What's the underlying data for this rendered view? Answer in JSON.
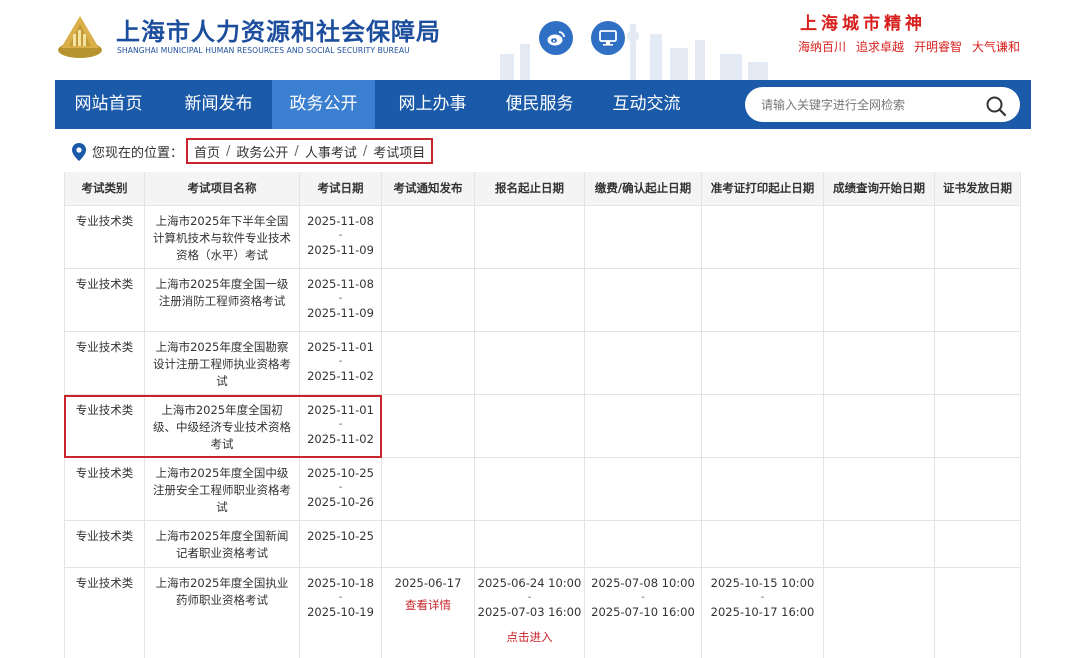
{
  "header": {
    "title": "上海市人力资源和社会保障局",
    "subtitle": "SHANGHAI MUNICIPAL HUMAN RESOURCES AND SOCIAL SECURITY BUREAU",
    "spirit_title": "上海城市精神",
    "spirit_items": [
      "海纳百川",
      "追求卓越",
      "开明睿智",
      "大气谦和"
    ],
    "icons": [
      "weibo-icon",
      "screen-icon"
    ]
  },
  "nav": {
    "items": [
      "网站首页",
      "新闻发布",
      "政务公开",
      "网上办事",
      "便民服务",
      "互动交流"
    ],
    "active_index": 2,
    "search_placeholder": "请输入关键字进行全网检索"
  },
  "breadcrumb": {
    "label": "您现在的位置：",
    "items": [
      "首页",
      "政务公开",
      "人事考试",
      "考试项目"
    ]
  },
  "table": {
    "headers": [
      "考试类别",
      "考试项目名称",
      "考试日期",
      "考试通知发布",
      "报名起止日期",
      "缴费/确认起止日期",
      "准考证打印起止日期",
      "成绩查询开始日期",
      "证书发放日期"
    ],
    "rows": [
      {
        "category": "专业技术类",
        "name": "上海市2025年下半年全国计算机技术与软件专业技术资格（水平）考试",
        "exam_start": "2025-11-08",
        "exam_end": "2025-11-09"
      },
      {
        "category": "专业技术类",
        "name": "上海市2025年度全国一级注册消防工程师资格考试",
        "exam_start": "2025-11-08",
        "exam_end": "2025-11-09"
      },
      {
        "category": "专业技术类",
        "name": "上海市2025年度全国勘察设计注册工程师执业资格考试",
        "exam_start": "2025-11-01",
        "exam_end": "2025-11-02"
      },
      {
        "category": "专业技术类",
        "name": "上海市2025年度全国初级、中级经济专业技术资格考试",
        "exam_start": "2025-11-01",
        "exam_end": "2025-11-02",
        "highlighted": true
      },
      {
        "category": "专业技术类",
        "name": "上海市2025年度全国中级注册安全工程师职业资格考试",
        "exam_start": "2025-10-25",
        "exam_end": "2025-10-26"
      },
      {
        "category": "专业技术类",
        "name": "上海市2025年度全国新闻记者职业资格考试",
        "exam_start": "2025-10-25"
      },
      {
        "category": "专业技术类",
        "name": "上海市2025年度全国执业药师职业资格考试",
        "exam_start": "2025-10-18",
        "exam_end": "2025-10-19",
        "notice_date": "2025-06-17",
        "notice_link": "查看详情",
        "reg_start": "2025-06-24 10:00",
        "reg_end": "2025-07-03 16:00",
        "reg_link": "点击进入",
        "pay_start": "2025-07-08 10:00",
        "pay_end": "2025-07-10 16:00",
        "ticket_start": "2025-10-15 10:00",
        "ticket_end": "2025-10-17 16:00"
      }
    ],
    "dash": "-"
  },
  "colors": {
    "nav": "#1a5aa8",
    "nav_active": "#3a7fd0",
    "title": "#1d4e9e",
    "highlight": "#c8242b"
  }
}
